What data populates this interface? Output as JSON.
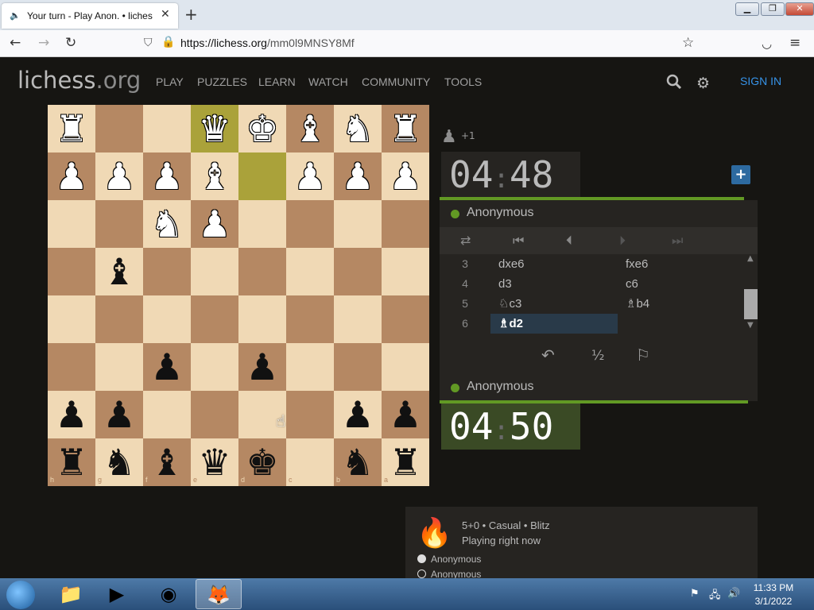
{
  "browser": {
    "tab_title": "Your turn - Play Anon. • liches",
    "url_host": "https://lichess.org",
    "url_path": "/mm0l9MNSY8Mf"
  },
  "site": {
    "logo_main": "lichess",
    "logo_domain": ".org",
    "menu": [
      "PLAY",
      "PUZZLES",
      "LEARN",
      "WATCH",
      "COMMUNITY",
      "TOOLS"
    ],
    "sign_in": "SIGN IN"
  },
  "board": {
    "orientation": "black",
    "last_move_squares": [
      "e1",
      "d2"
    ],
    "pieces": [
      {
        "sq": "a1",
        "glyph": "♜",
        "color": "w"
      },
      {
        "sq": "b1",
        "glyph": "♞",
        "color": "w"
      },
      {
        "sq": "c1",
        "glyph": "♝",
        "color": "w"
      },
      {
        "sq": "d1",
        "glyph": "♚",
        "color": "w"
      },
      {
        "sq": "e1",
        "glyph": "♛",
        "color": "w"
      },
      {
        "sq": "h1",
        "glyph": "♜",
        "color": "w"
      },
      {
        "sq": "a2",
        "glyph": "♟",
        "color": "w"
      },
      {
        "sq": "b2",
        "glyph": "♟",
        "color": "w"
      },
      {
        "sq": "c2",
        "glyph": "♟",
        "color": "w"
      },
      {
        "sq": "e2",
        "glyph": "♝",
        "color": "w"
      },
      {
        "sq": "f2",
        "glyph": "♟",
        "color": "w"
      },
      {
        "sq": "g2",
        "glyph": "♟",
        "color": "w"
      },
      {
        "sq": "h2",
        "glyph": "♟",
        "color": "w"
      },
      {
        "sq": "e3",
        "glyph": "♟",
        "color": "w"
      },
      {
        "sq": "f3",
        "glyph": "♞",
        "color": "w"
      },
      {
        "sq": "g4",
        "glyph": "♝",
        "color": "b"
      },
      {
        "sq": "d6",
        "glyph": "♟",
        "color": "b"
      },
      {
        "sq": "f6",
        "glyph": "♟",
        "color": "b"
      },
      {
        "sq": "a7",
        "glyph": "♟",
        "color": "b"
      },
      {
        "sq": "b7",
        "glyph": "♟",
        "color": "b"
      },
      {
        "sq": "g7",
        "glyph": "♟",
        "color": "b"
      },
      {
        "sq": "h7",
        "glyph": "♟",
        "color": "b"
      },
      {
        "sq": "a8",
        "glyph": "♜",
        "color": "b"
      },
      {
        "sq": "b8",
        "glyph": "♞",
        "color": "b"
      },
      {
        "sq": "d8",
        "glyph": "♚",
        "color": "b"
      },
      {
        "sq": "e8",
        "glyph": "♛",
        "color": "b"
      },
      {
        "sq": "f8",
        "glyph": "♝",
        "color": "b"
      },
      {
        "sq": "g8",
        "glyph": "♞",
        "color": "b"
      },
      {
        "sq": "h8",
        "glyph": "♜",
        "color": "b"
      }
    ],
    "rank_labels": [
      "1",
      "2",
      "3",
      "4",
      "5",
      "6",
      "7",
      "8"
    ],
    "file_labels": [
      "h",
      "g",
      "f",
      "e",
      "d",
      "c",
      "b",
      "a"
    ]
  },
  "game": {
    "pocket_count": "+1",
    "top_player": {
      "name": "Anonymous",
      "clock_min": "04",
      "clock_sec": "48"
    },
    "bottom_player": {
      "name": "Anonymous",
      "clock_min": "04",
      "clock_sec": "50"
    },
    "moves": [
      {
        "no": "3",
        "white": "dxe6",
        "black": "fxe6"
      },
      {
        "no": "4",
        "white": "d3",
        "black": "c6"
      },
      {
        "no": "5",
        "white": "♘c3",
        "black": "♗b4"
      },
      {
        "no": "6",
        "white": "♗d2",
        "black": ""
      }
    ],
    "draw_label": "½"
  },
  "info": {
    "line1": "5+0 • Casual • Blitz",
    "line2": "Playing right now",
    "player1": "Anonymous",
    "player2": "Anonymous"
  },
  "taskbar": {
    "time": "11:33 PM",
    "date": "3/1/2022"
  },
  "colors": {
    "light_square": "#f0d9b5",
    "dark_square": "#b58863",
    "highlight": "#aaa23a",
    "accent_green": "#629924",
    "link_blue": "#3692e7"
  }
}
